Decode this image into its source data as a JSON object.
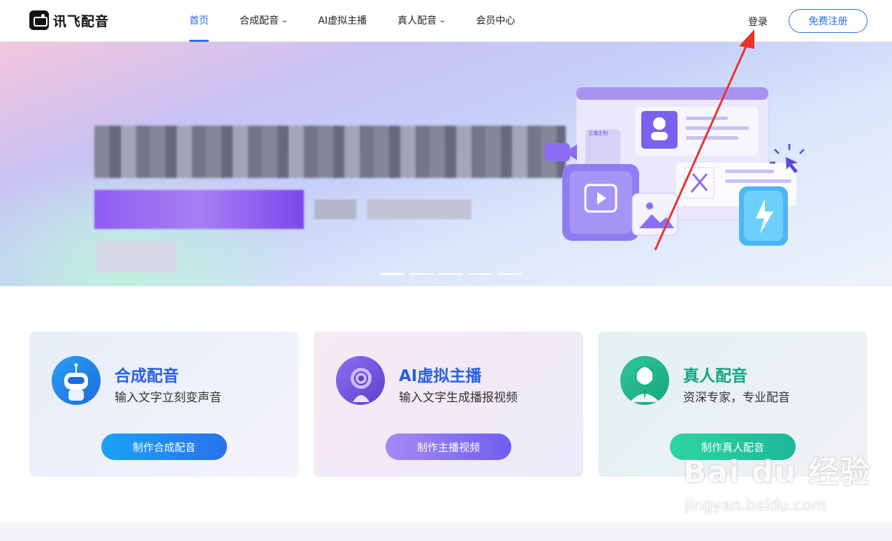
{
  "header": {
    "logo_text": "讯飞配音",
    "nav": [
      {
        "label": "首页",
        "active": true,
        "has_dropdown": false
      },
      {
        "label": "合成配音",
        "active": false,
        "has_dropdown": true
      },
      {
        "label": "AI虚拟主播",
        "active": false,
        "has_dropdown": false
      },
      {
        "label": "真人配音",
        "active": false,
        "has_dropdown": true
      },
      {
        "label": "会员中心",
        "active": false,
        "has_dropdown": false
      }
    ],
    "login_label": "登录",
    "register_label": "免费注册"
  },
  "banner": {
    "illustration_tag": "主播定制",
    "slides": 5,
    "active_slide": 1
  },
  "cards": [
    {
      "title": "合成配音",
      "desc": "输入文字立刻变声音",
      "button": "制作合成配音",
      "icon": "robot-icon"
    },
    {
      "title": "AI虚拟主播",
      "desc": "输入文字生成播报视频",
      "button": "制作主播视频",
      "icon": "virtual-anchor-icon"
    },
    {
      "title": "真人配音",
      "desc": "资深专家，专业配音",
      "button": "制作真人配音",
      "icon": "voice-actor-icon"
    }
  ],
  "watermark": {
    "brand": "Bai du 经验",
    "url": "jingyan.baidu.com"
  },
  "colors": {
    "accent": "#2a6ff1",
    "annotation_arrow": "#e8352b"
  }
}
